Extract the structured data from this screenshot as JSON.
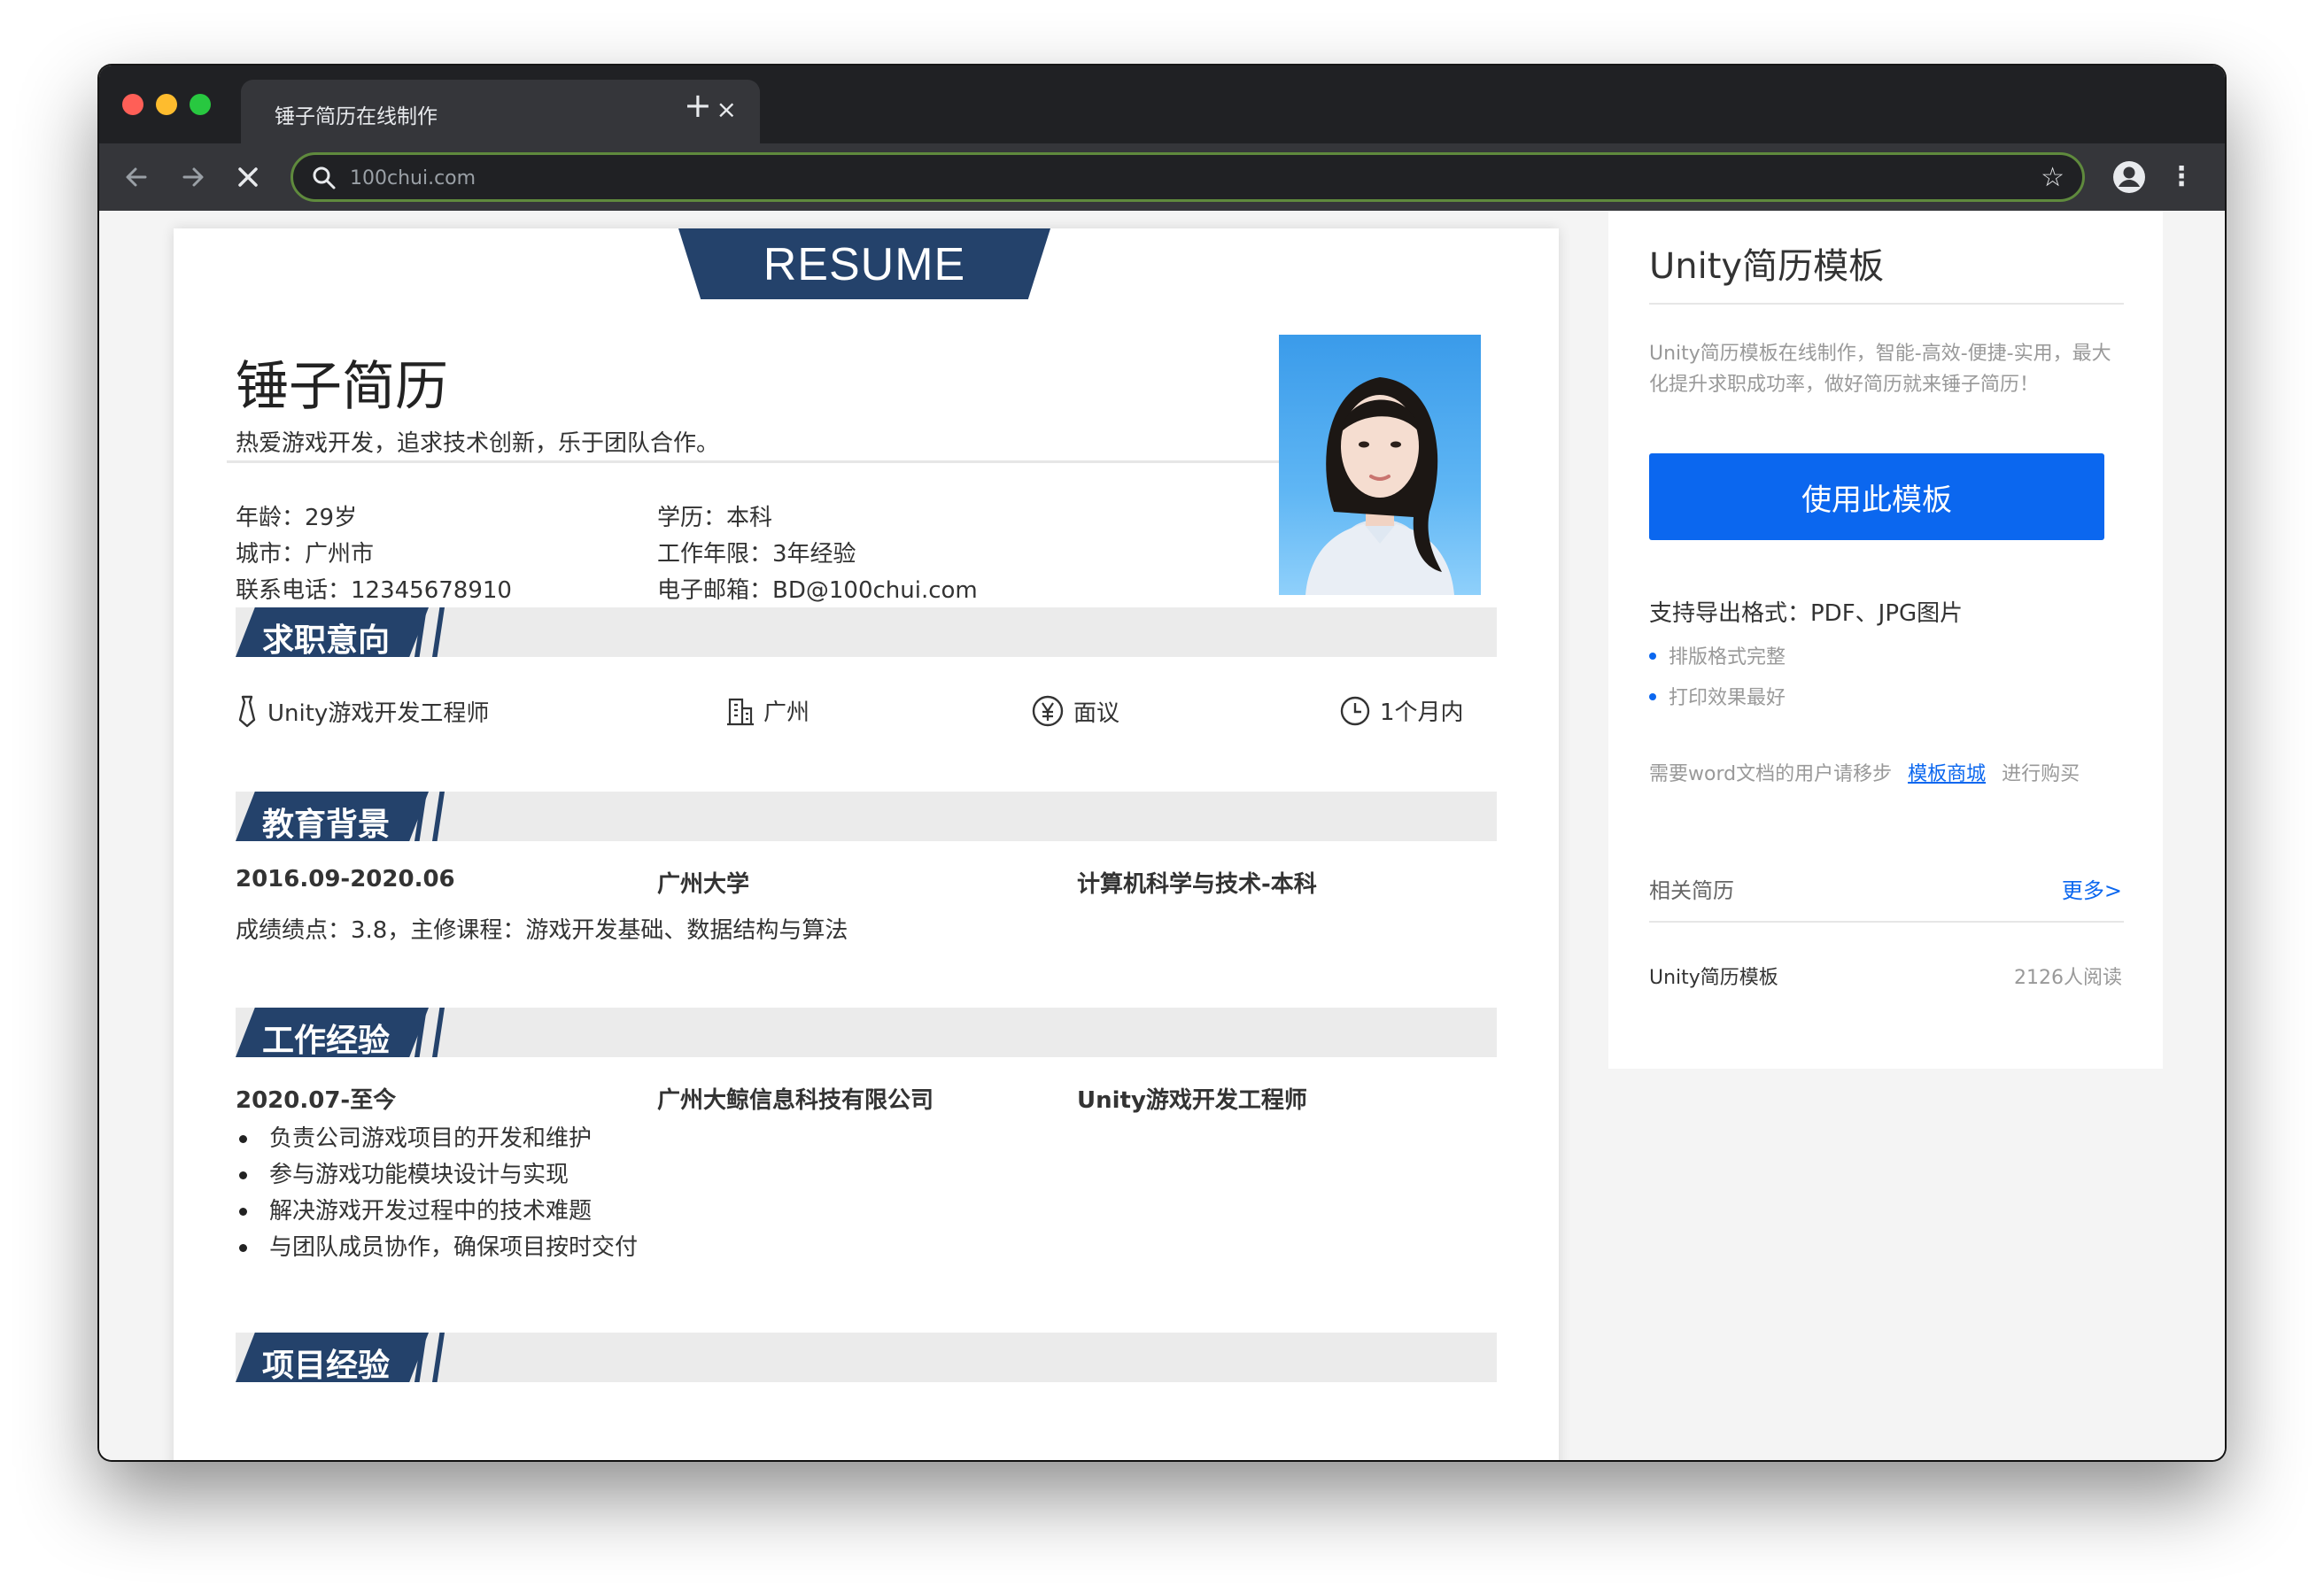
{
  "browser": {
    "tab_title": "锤子简历在线制作",
    "tab_close": "×",
    "new_tab": "+",
    "url": "100chui.com"
  },
  "resume": {
    "banner": "RESUME",
    "name": "锤子简历",
    "slogan": "热爱游戏开发，追求技术创新，乐于团队合作。",
    "info": {
      "age": "年龄：29岁",
      "education": "学历：本科",
      "city": "城市：广州市",
      "experience_years": "工作年限：3年经验",
      "phone": "联系电话：12345678910",
      "email": "电子邮箱：BD@100chui.com"
    },
    "sections": {
      "intent": "求职意向",
      "education": "教育背景",
      "work": "工作经验",
      "project": "项目经验"
    },
    "intent": {
      "position": "Unity游戏开发工程师",
      "city": "广州",
      "salary": "面议",
      "arrival": "1个月内"
    },
    "education": {
      "period": "2016.09-2020.06",
      "school": "广州大学",
      "major": "计算机科学与技术-本科",
      "detail": "成绩绩点：3.8，主修课程：游戏开发基础、数据结构与算法"
    },
    "work": {
      "period": "2020.07-至今",
      "company": "广州大鲸信息科技有限公司",
      "title": "Unity游戏开发工程师",
      "duties": [
        "负责公司游戏项目的开发和维护",
        "参与游戏功能模块设计与实现",
        "解决游戏开发过程中的技术难题",
        "与团队成员协作，确保项目按时交付"
      ]
    }
  },
  "sidebar": {
    "title": "Unity简历模板",
    "desc": "Unity简历模板在线制作，智能-高效-便捷-实用，最大化提升求职成功率，做好简历就来锤子简历！",
    "use_button": "使用此模板",
    "export_title": "支持导出格式：PDF、JPG图片",
    "features": [
      "排版格式完整",
      "打印效果最好"
    ],
    "word_prefix": "需要word文档的用户请移步",
    "word_link": "模板商城",
    "word_suffix": "进行购买",
    "related_title": "相关简历",
    "more": "更多>",
    "related": [
      {
        "name": "Unity简历模板",
        "reads": "2126人阅读"
      }
    ]
  },
  "colors": {
    "accent_navy": "#24426b",
    "button_blue": "#0b67ef",
    "chrome_dark": "#202124"
  },
  "icons": [
    "search-icon",
    "star-icon",
    "profile-icon",
    "menu-icon",
    "tie-icon",
    "building-icon",
    "yen-icon",
    "clock-icon"
  ]
}
